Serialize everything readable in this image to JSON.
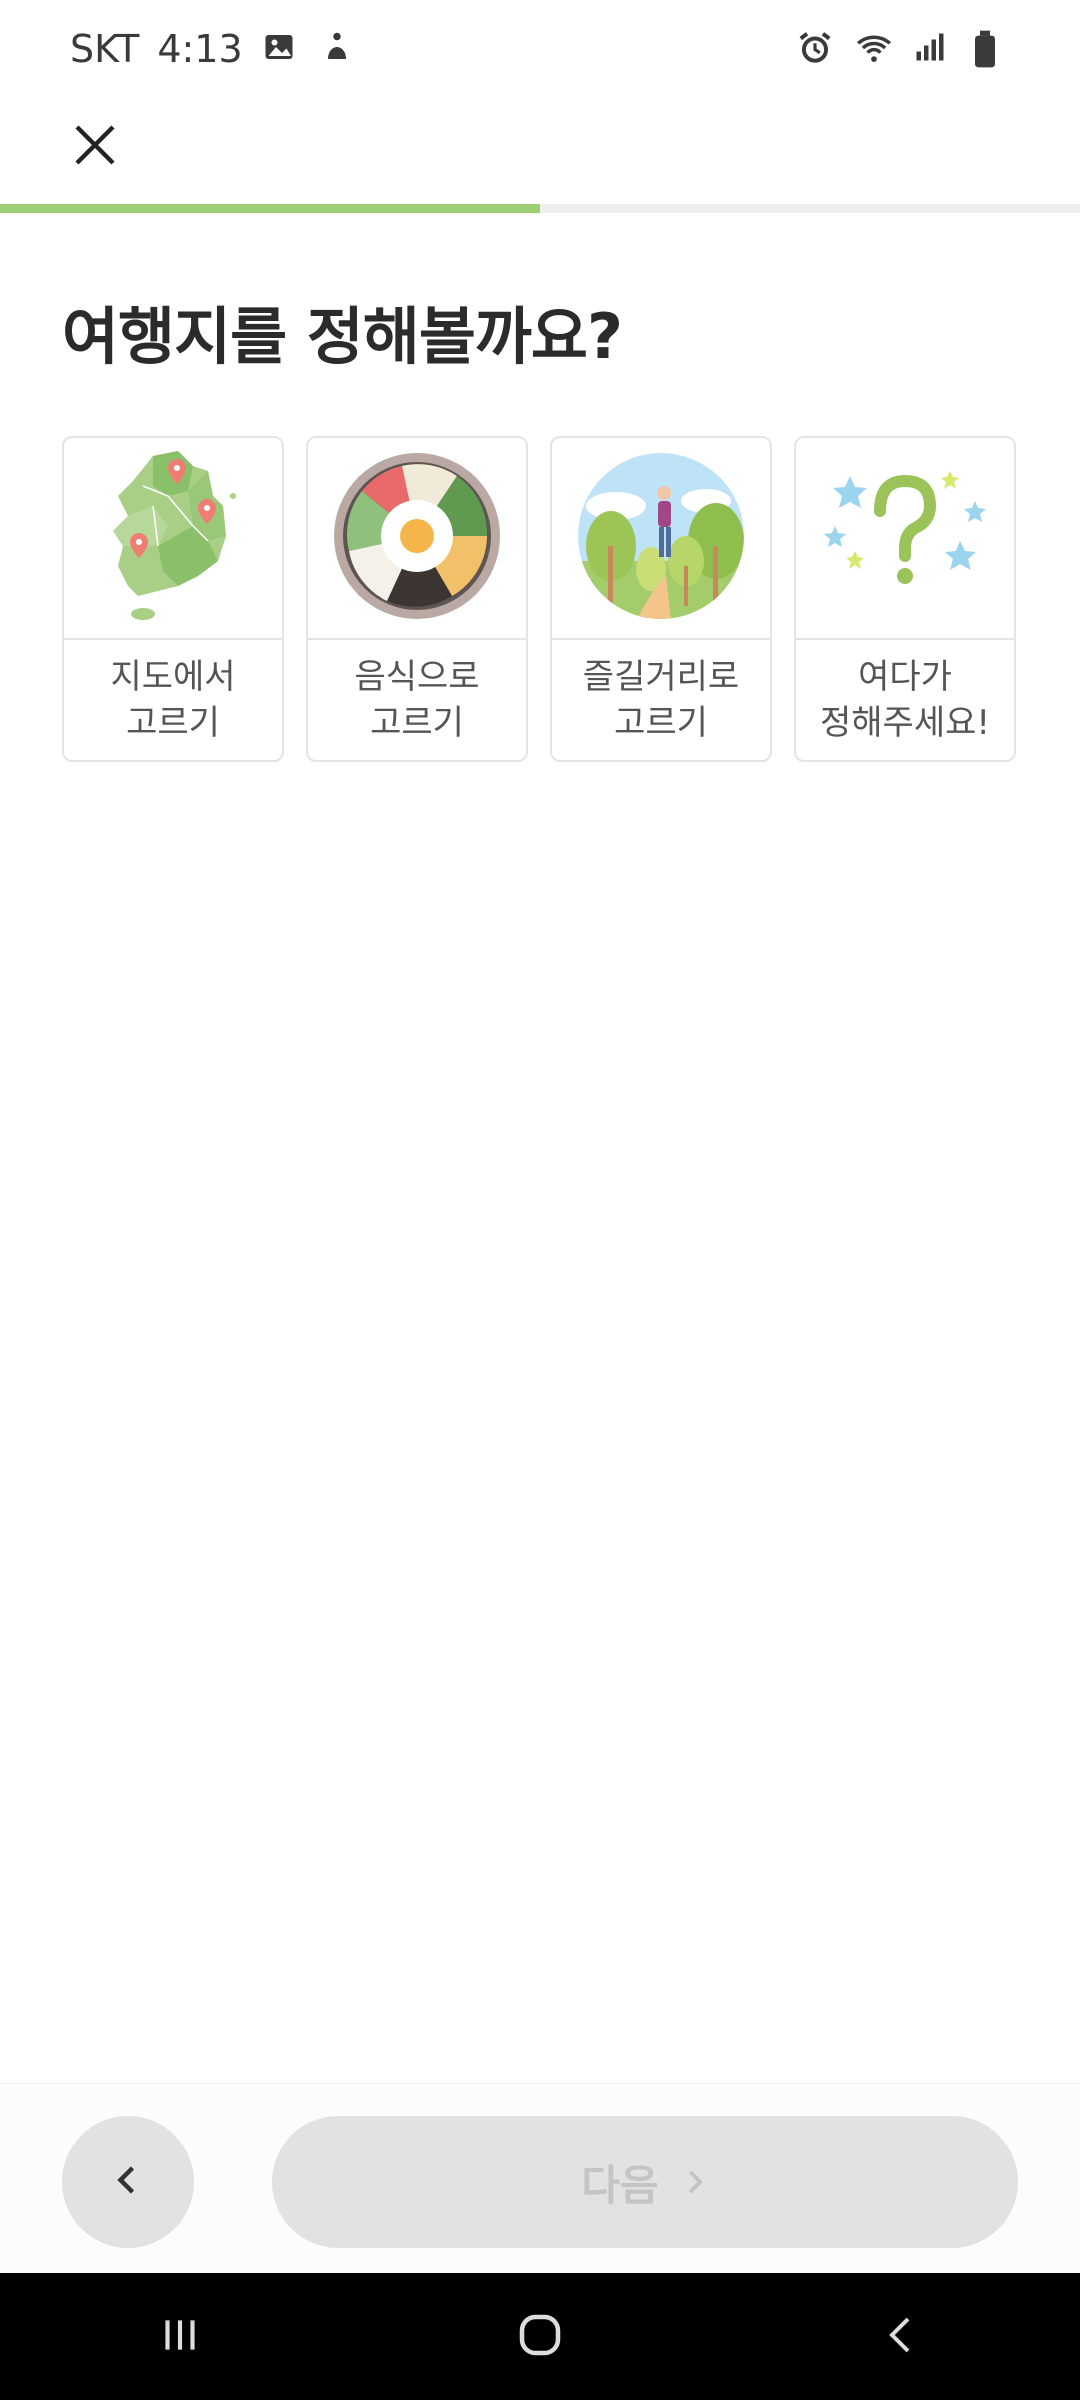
{
  "status_bar": {
    "carrier": "SKT",
    "time": "4:13",
    "icons_left": [
      "gallery-icon",
      "accessibility-icon"
    ],
    "icons_right": [
      "alarm-icon",
      "wifi-icon",
      "signal-icon",
      "battery-icon"
    ]
  },
  "header": {
    "close_icon": "close-icon",
    "progress_fraction": 0.5
  },
  "main": {
    "title": "여행지를 정해볼까요?",
    "options": [
      {
        "label": "지도에서\n고르기",
        "icon": "korea-map-icon"
      },
      {
        "label": "음식으로\n고르기",
        "icon": "bibimbap-icon"
      },
      {
        "label": "즐길거리로\n고르기",
        "icon": "hiking-icon"
      },
      {
        "label": "여다가\n정해주세요!",
        "icon": "question-stars-icon"
      }
    ]
  },
  "footer": {
    "back_icon": "chevron-left-icon",
    "next_label": "다음",
    "next_icon": "chevron-right-icon"
  },
  "nav": {
    "items": [
      "recents-icon",
      "home-icon",
      "back-icon"
    ]
  },
  "colors": {
    "accent": "#9cce76",
    "button_bg": "#e2e2e2",
    "button_text": "#c4c4c4"
  }
}
